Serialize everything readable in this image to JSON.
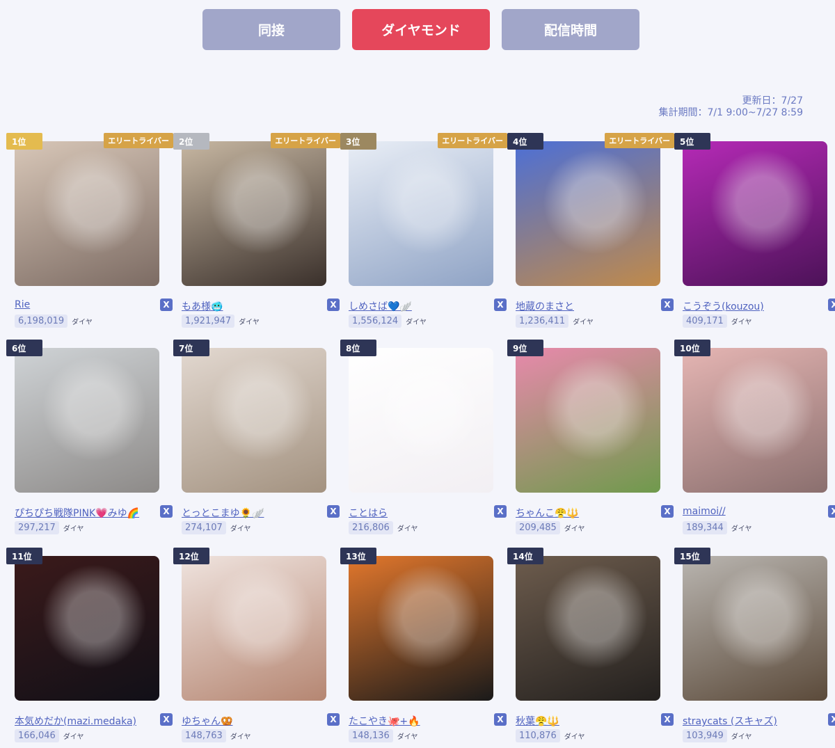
{
  "tabs": [
    {
      "label": "同接"
    },
    {
      "label": "ダイヤモンド"
    },
    {
      "label": "配信時間"
    }
  ],
  "meta": {
    "updated": "更新日：7/27",
    "period": "集計期間：7/1 9:00~7/27 8:59"
  },
  "elite_label": "エリートライバー",
  "diamond_unit": "ダイヤ",
  "x_icon": "X",
  "colors": {
    "accent": "#e5475b",
    "tab_inactive": "#a1a6c9",
    "gold": "#e4bb4f",
    "silver": "#b5b8bf",
    "bronze": "#9c8860",
    "elite": "#d6a347",
    "link": "#4f62bf"
  },
  "rankings": [
    {
      "rank": "1位",
      "name": "Rie",
      "diamonds": "6,198,019",
      "elite": true,
      "image_icon": "portrait-photo",
      "tint": [
        "#d8c7b8",
        "#7c6b63"
      ]
    },
    {
      "rank": "2位",
      "name": "もあ様🥶",
      "diamonds": "1,921,947",
      "elite": true,
      "image_icon": "portrait-photo",
      "tint": [
        "#c7b7a2",
        "#3a302b"
      ]
    },
    {
      "rank": "3位",
      "name": "しめさば💙🪽",
      "diamonds": "1,556,124",
      "elite": true,
      "image_icon": "gang-emblem",
      "tint": [
        "#e9eef6",
        "#8fa3c5"
      ]
    },
    {
      "rank": "4位",
      "name": "地蔵のまさと",
      "diamonds": "1,236,411",
      "elite": true,
      "image_icon": "ornate-frame-portrait",
      "tint": [
        "#4c6fd6",
        "#c08a4a"
      ]
    },
    {
      "rank": "5位",
      "name": "こうぞう(kouzou)",
      "diamonds": "409,171",
      "elite": false,
      "image_icon": "neon-portrait",
      "tint": [
        "#b52ab6",
        "#4c1258"
      ]
    },
    {
      "rank": "6位",
      "name": "ぴちぴち戦隊PINK💗みゆ🌈",
      "diamonds": "297,217",
      "elite": false,
      "image_icon": "portrait-photo",
      "tint": [
        "#cfd3d6",
        "#8d8a88"
      ]
    },
    {
      "rank": "7位",
      "name": "とっとこまゆ🌻🪽",
      "diamonds": "274,107",
      "elite": false,
      "image_icon": "portrait-photo",
      "tint": [
        "#e2d8d0",
        "#a39280"
      ]
    },
    {
      "rank": "8位",
      "name": "ことはら",
      "diamonds": "216,806",
      "elite": false,
      "image_icon": "illustration",
      "tint": [
        "#ffffff",
        "#f2eff3"
      ]
    },
    {
      "rank": "9位",
      "name": "ちゃんこ😤🔱",
      "diamonds": "209,485",
      "elite": false,
      "image_icon": "flowers-portrait",
      "tint": [
        "#e889ac",
        "#6f9a4c"
      ]
    },
    {
      "rank": "10位",
      "name": "maimoi//",
      "diamonds": "189,344",
      "elite": false,
      "image_icon": "portrait-photo",
      "tint": [
        "#e5b5b3",
        "#8a6f6e"
      ]
    },
    {
      "rank": "11位",
      "name": "本気めだか(mazi.medaka)",
      "diamonds": "166,046",
      "elite": false,
      "image_icon": "calligraphy-logo",
      "tint": [
        "#3b1a1a",
        "#111018"
      ]
    },
    {
      "rank": "12位",
      "name": "ゆちゃん🥨",
      "diamonds": "148,763",
      "elite": false,
      "image_icon": "portrait-photo",
      "tint": [
        "#efe3de",
        "#b58672"
      ]
    },
    {
      "rank": "13位",
      "name": "たこやき🐙+🔥",
      "diamonds": "148,136",
      "elite": false,
      "image_icon": "guitar-illustration",
      "tint": [
        "#e2772c",
        "#1a1a1a"
      ]
    },
    {
      "rank": "14位",
      "name": "秋葉😤🔱",
      "diamonds": "110,876",
      "elite": false,
      "image_icon": "portrait-photo",
      "tint": [
        "#6d5c4d",
        "#23201e"
      ]
    },
    {
      "rank": "15位",
      "name": "straycats (スキャズ)",
      "diamonds": "103,949",
      "elite": false,
      "image_icon": "cat-photo",
      "tint": [
        "#b9b5b0",
        "#5b4a3a"
      ]
    }
  ]
}
